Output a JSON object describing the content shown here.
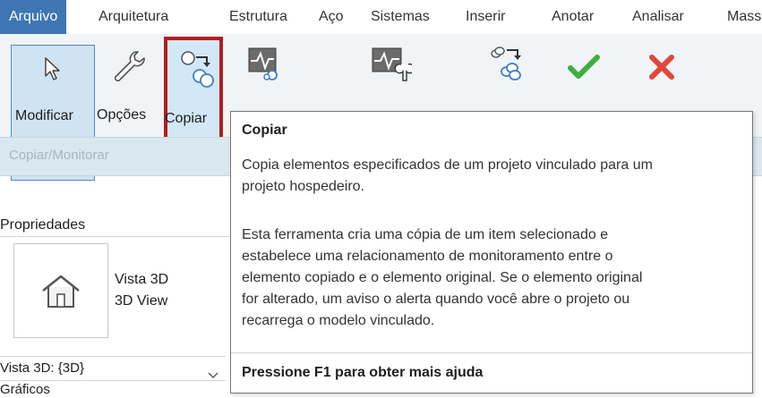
{
  "menu_tabs": [
    "Arquivo",
    "Arquitetura",
    "Estrutura",
    "Aço",
    "Sistemas",
    "Inserir",
    "Anotar",
    "Analisar",
    "Mass"
  ],
  "ribbon": {
    "tools": {
      "modificar": "Modificar",
      "opcoes": "Opções",
      "copiar": "Copiar"
    },
    "panel_label": "Copiar/Monitorar"
  },
  "icons": {
    "cursor": "cursor-arrow-icon",
    "wrench": "wrench-icon",
    "copy": "copy-circles-icon",
    "monitor": "monitor-graph-icon",
    "coordination": "coordination-review-icon",
    "batch_copy": "batch-copy-icon",
    "finish": "green-check-icon",
    "cancel": "red-x-icon",
    "house": "house-3d-icon"
  },
  "properties": {
    "title": "Propriedades",
    "type_name_line1": "Vista 3D",
    "type_name_line2": "3D View",
    "view_selector": "Vista 3D: {3D}",
    "group_label": "Gráficos"
  },
  "tooltip": {
    "title": "Copiar",
    "summary_line1": "Copia elementos especificados de um projeto vinculado para um",
    "summary_line2": "projeto hospedeiro.",
    "detail_line1": "Esta ferramenta cria uma cópia de um item selecionado e",
    "detail_line2": "estabelece uma relacionamento de monitoramento entre o",
    "detail_line3": "elemento copiado e o elemento original. Se o elemento original",
    "detail_line4": "for alterado, um aviso o alerta quando você abre o projeto ou",
    "detail_line5": "recarrega o modelo vinculado.",
    "help": "Pressione F1 para obter mais ajuda"
  },
  "colors": {
    "active_tab": "#3d76b3",
    "highlight_border": "#b21e1e",
    "check": "#3fae3f",
    "cancel": "#e0473a"
  }
}
